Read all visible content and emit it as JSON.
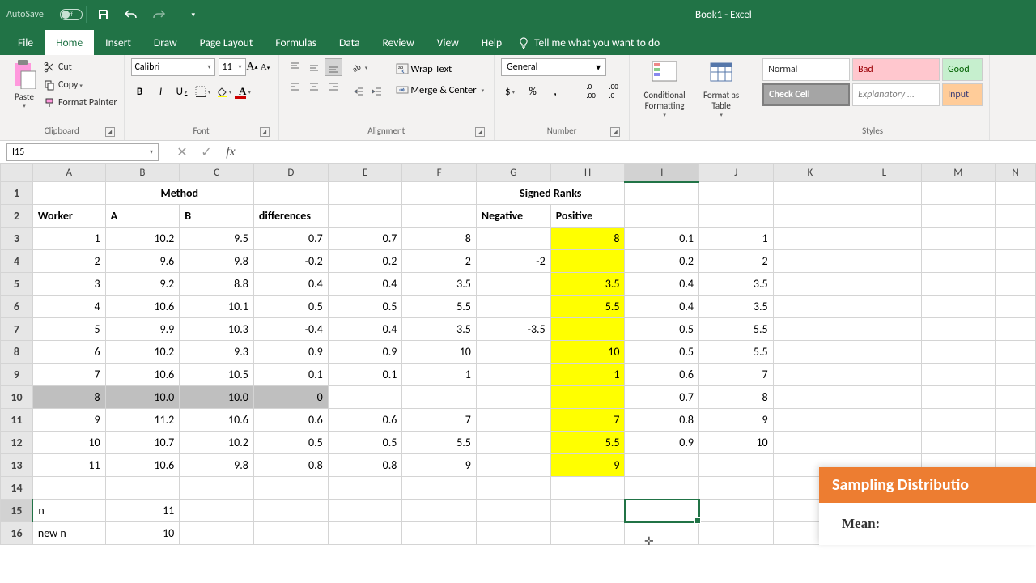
{
  "title_bar": {
    "autosave": "AutoSave",
    "autosave_state": "Off",
    "app_title": "Book1  -  Excel"
  },
  "tabs": {
    "file": "File",
    "home": "Home",
    "insert": "Insert",
    "draw": "Draw",
    "page_layout": "Page Layout",
    "formulas": "Formulas",
    "data": "Data",
    "review": "Review",
    "view": "View",
    "help": "Help",
    "tell_me": "Tell me what you want to do"
  },
  "ribbon": {
    "clipboard": {
      "label": "Clipboard",
      "paste": "Paste",
      "cut": "Cut",
      "copy": "Copy",
      "format_painter": "Format Painter"
    },
    "font": {
      "label": "Font",
      "name": "Calibri",
      "size": "11"
    },
    "alignment": {
      "label": "Alignment",
      "wrap": "Wrap Text",
      "merge": "Merge & Center"
    },
    "number": {
      "label": "Number",
      "format": "General"
    },
    "cond_fmt": "Conditional Formatting",
    "fmt_table": "Format as Table",
    "styles": {
      "label": "Styles",
      "normal": "Normal",
      "bad": "Bad",
      "good": "Good",
      "check": "Check Cell",
      "explanatory": "Explanatory ...",
      "input": "Input"
    }
  },
  "name_box": "I15",
  "columns": [
    "A",
    "B",
    "C",
    "D",
    "E",
    "F",
    "G",
    "H",
    "I",
    "J",
    "K",
    "L",
    "M",
    "N"
  ],
  "row_labels": [
    "1",
    "2",
    "3",
    "4",
    "5",
    "6",
    "7",
    "8",
    "9",
    "10",
    "11",
    "12",
    "13",
    "14",
    "15",
    "16"
  ],
  "headers": {
    "method": "Method",
    "signed_ranks": "Signed Ranks",
    "worker": "Worker",
    "a": "A",
    "b": "B",
    "differences": "differences",
    "negative": "Negative",
    "positive": "Positive"
  },
  "rows": [
    {
      "w": "1",
      "a": "10.2",
      "b": "9.5",
      "d": "0.7",
      "e": "0.7",
      "f": "8",
      "g": "",
      "h": "8",
      "i": "0.1",
      "j": "1"
    },
    {
      "w": "2",
      "a": "9.6",
      "b": "9.8",
      "d": "-0.2",
      "e": "0.2",
      "f": "2",
      "g": "-2",
      "h": "",
      "i": "0.2",
      "j": "2"
    },
    {
      "w": "3",
      "a": "9.2",
      "b": "8.8",
      "d": "0.4",
      "e": "0.4",
      "f": "3.5",
      "g": "",
      "h": "3.5",
      "i": "0.4",
      "j": "3.5"
    },
    {
      "w": "4",
      "a": "10.6",
      "b": "10.1",
      "d": "0.5",
      "e": "0.5",
      "f": "5.5",
      "g": "",
      "h": "5.5",
      "i": "0.4",
      "j": "3.5"
    },
    {
      "w": "5",
      "a": "9.9",
      "b": "10.3",
      "d": "-0.4",
      "e": "0.4",
      "f": "3.5",
      "g": "-3.5",
      "h": "",
      "i": "0.5",
      "j": "5.5"
    },
    {
      "w": "6",
      "a": "10.2",
      "b": "9.3",
      "d": "0.9",
      "e": "0.9",
      "f": "10",
      "g": "",
      "h": "10",
      "i": "0.5",
      "j": "5.5"
    },
    {
      "w": "7",
      "a": "10.6",
      "b": "10.5",
      "d": "0.1",
      "e": "0.1",
      "f": "1",
      "g": "",
      "h": "1",
      "i": "0.6",
      "j": "7"
    },
    {
      "w": "8",
      "a": "10.0",
      "b": "10.0",
      "d": "0",
      "e": "",
      "f": "",
      "g": "",
      "h": "",
      "i": "0.7",
      "j": "8"
    },
    {
      "w": "9",
      "a": "11.2",
      "b": "10.6",
      "d": "0.6",
      "e": "0.6",
      "f": "7",
      "g": "",
      "h": "7",
      "i": "0.8",
      "j": "9"
    },
    {
      "w": "10",
      "a": "10.7",
      "b": "10.2",
      "d": "0.5",
      "e": "0.5",
      "f": "5.5",
      "g": "",
      "h": "5.5",
      "i": "0.9",
      "j": "10"
    },
    {
      "w": "11",
      "a": "10.6",
      "b": "9.8",
      "d": "0.8",
      "e": "0.8",
      "f": "9",
      "g": "",
      "h": "9",
      "i": "",
      "j": ""
    }
  ],
  "summary": {
    "n_label": "n",
    "n_val": "11",
    "newn_label": "new n",
    "newn_val": "10"
  },
  "popup": {
    "title": "Sampling Distributio",
    "mean": "Mean:"
  }
}
